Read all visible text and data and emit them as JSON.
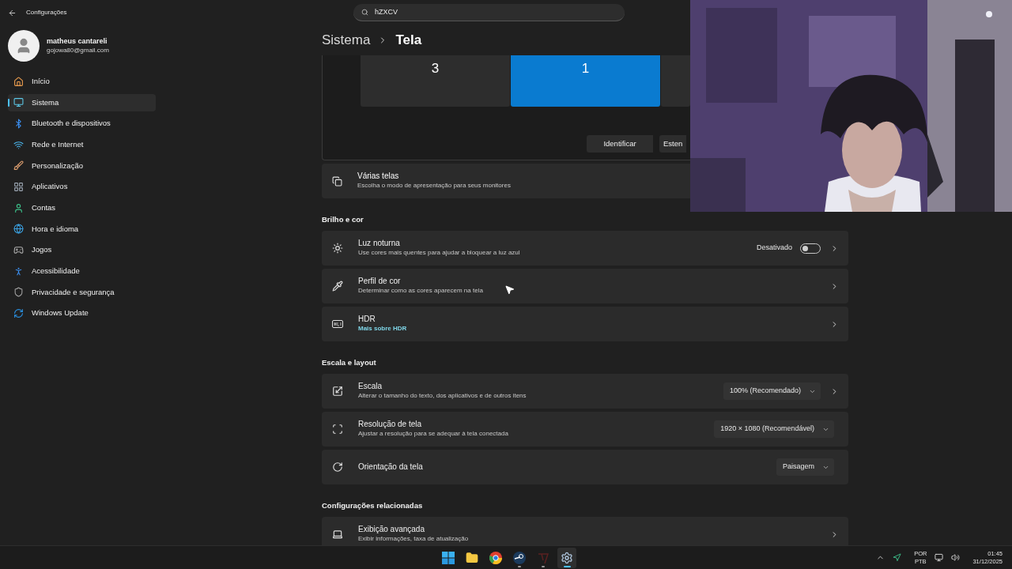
{
  "window": {
    "title": "Configurações"
  },
  "search": {
    "value": "hZXCV"
  },
  "profile": {
    "name": "matheus cantareli",
    "email": "gojowa80@gmail.com"
  },
  "sidebar": {
    "items": [
      {
        "label": "Início",
        "selected": false
      },
      {
        "label": "Sistema",
        "selected": true
      },
      {
        "label": "Bluetooth e dispositivos",
        "selected": false
      },
      {
        "label": "Rede e Internet",
        "selected": false
      },
      {
        "label": "Personalização",
        "selected": false
      },
      {
        "label": "Aplicativos",
        "selected": false
      },
      {
        "label": "Contas",
        "selected": false
      },
      {
        "label": "Hora e idioma",
        "selected": false
      },
      {
        "label": "Jogos",
        "selected": false
      },
      {
        "label": "Acessibilidade",
        "selected": false
      },
      {
        "label": "Privacidade e segurança",
        "selected": false
      },
      {
        "label": "Windows Update",
        "selected": false
      }
    ]
  },
  "breadcrumb": {
    "parent": "Sistema",
    "current": "Tela"
  },
  "display_arrangement": {
    "monitors": [
      {
        "label": "3",
        "selected": false
      },
      {
        "label": "1",
        "selected": true
      },
      {
        "selected": false
      }
    ],
    "buttons": [
      "Identificar",
      "Esten"
    ]
  },
  "multiple_displays": {
    "title": "Várias telas",
    "subtitle": "Escolha o modo de apresentação para seus monitores"
  },
  "sections": [
    {
      "heading": "Brilho e cor",
      "rows": [
        {
          "kind": "toggle",
          "title": "Luz noturna",
          "subtitle": "Use cores mais quentes para ajudar a bloquear a luz azul",
          "status": "Desativado",
          "on": false,
          "chevron": true
        },
        {
          "kind": "link",
          "title": "Perfil de cor",
          "subtitle": "Determinar como as cores aparecem na tela",
          "chevron": true
        },
        {
          "kind": "link",
          "title": "HDR",
          "link": "Mais sobre HDR",
          "chevron": true
        }
      ]
    },
    {
      "heading": "Escala e layout",
      "rows": [
        {
          "kind": "dropdown",
          "title": "Escala",
          "subtitle": "Alterar o tamanho do texto, dos aplicativos e de outros itens",
          "value": "100% (Recomendado)",
          "chevron": true
        },
        {
          "kind": "dropdown",
          "title": "Resolução de tela",
          "subtitle": "Ajustar a resolução para se adequar à tela conectada",
          "value": "1920 × 1080 (Recomendável)",
          "chevron": false
        },
        {
          "kind": "dropdown",
          "title": "Orientação da tela",
          "value": "Paisagem",
          "chevron": false
        }
      ]
    },
    {
      "heading": "Configurações relacionadas",
      "rows": [
        {
          "kind": "link",
          "title": "Exibição avançada",
          "subtitle": "Exibir informações, taxa de atualização",
          "chevron": true
        }
      ]
    }
  ],
  "taskbar": {
    "apps": [
      {
        "selected": false,
        "running": false
      },
      {
        "selected": false,
        "running": false
      },
      {
        "selected": false,
        "running": false
      },
      {
        "selected": false,
        "running": true
      },
      {
        "selected": false,
        "running": true
      },
      {
        "selected": true,
        "running": true
      }
    ],
    "language": "POR",
    "layout": "PTB",
    "time": "01:45",
    "date": "31/12/2025"
  }
}
